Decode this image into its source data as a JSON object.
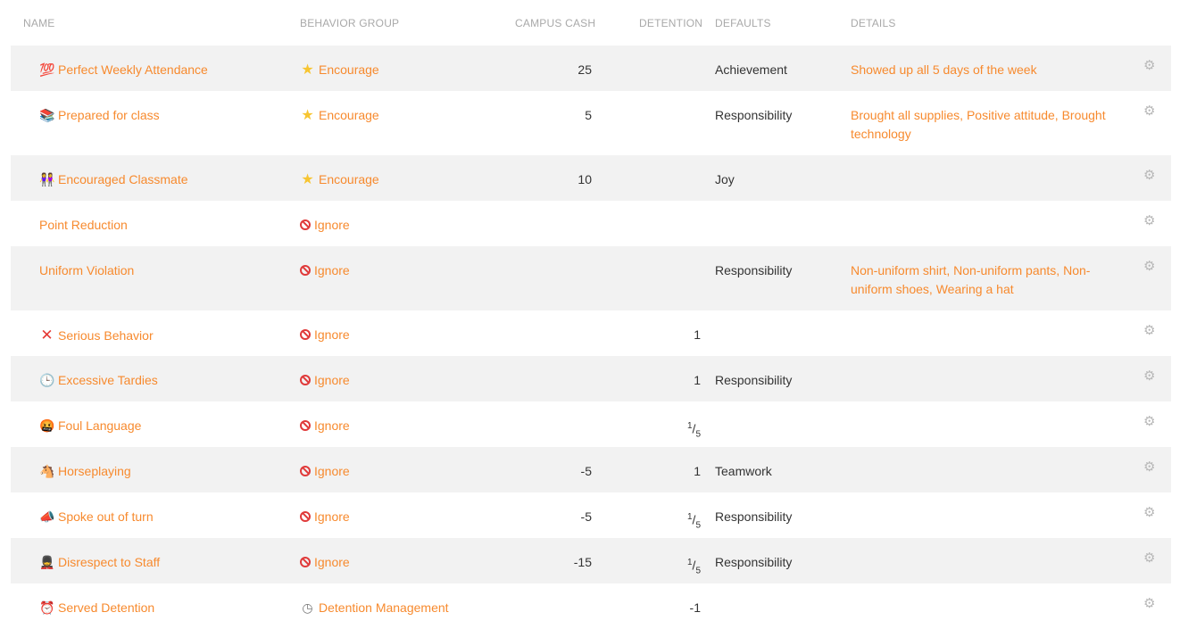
{
  "columns": {
    "name": "NAME",
    "group": "BEHAVIOR GROUP",
    "cash": "CAMPUS CASH",
    "detention": "DETENTION",
    "defaults": "DEFAULTS",
    "details": "DETAILS"
  },
  "rows": [
    {
      "icon": "hundred-points-icon",
      "name": "Perfect Weekly Attendance",
      "group_icon": "star-icon",
      "group": "Encourage",
      "cash": "25",
      "detention": "",
      "defaults": "Achievement",
      "details": "Showed up all 5 days of the week"
    },
    {
      "icon": "books-icon",
      "name": "Prepared for class",
      "group_icon": "star-icon",
      "group": "Encourage",
      "cash": "5",
      "detention": "",
      "defaults": "Responsibility",
      "details": "Brought all supplies, Positive attitude, Brought technology"
    },
    {
      "icon": "people-holding-hands-icon",
      "name": "Encouraged Classmate",
      "group_icon": "star-icon",
      "group": "Encourage",
      "cash": "10",
      "detention": "",
      "defaults": "Joy",
      "details": ""
    },
    {
      "icon": "",
      "name": "Point Reduction",
      "group_icon": "no-entry-icon",
      "group": "Ignore",
      "cash": "",
      "detention": "",
      "defaults": "",
      "details": ""
    },
    {
      "icon": "",
      "name": "Uniform Violation",
      "group_icon": "no-entry-icon",
      "group": "Ignore",
      "cash": "",
      "detention": "",
      "defaults": "Responsibility",
      "details": "Non-uniform shirt, Non-uniform pants, Non-uniform shoes, Wearing a hat"
    },
    {
      "icon": "cross-mark-icon",
      "name": "Serious Behavior",
      "group_icon": "no-entry-icon",
      "group": "Ignore",
      "cash": "",
      "detention": "1",
      "defaults": "",
      "details": ""
    },
    {
      "icon": "clock-icon",
      "name": "Excessive Tardies",
      "group_icon": "no-entry-icon",
      "group": "Ignore",
      "cash": "",
      "detention": "1",
      "defaults": "Responsibility",
      "details": ""
    },
    {
      "icon": "cursing-face-icon",
      "name": "Foul Language",
      "group_icon": "no-entry-icon",
      "group": "Ignore",
      "cash": "",
      "detention": "1/5",
      "defaults": "",
      "details": ""
    },
    {
      "icon": "horse-icon",
      "name": "Horseplaying",
      "group_icon": "no-entry-icon",
      "group": "Ignore",
      "cash": "-5",
      "detention": "1",
      "defaults": "Teamwork",
      "details": ""
    },
    {
      "icon": "megaphone-icon",
      "name": "Spoke out of turn",
      "group_icon": "no-entry-icon",
      "group": "Ignore",
      "cash": "-5",
      "detention": "1/5",
      "defaults": "Responsibility",
      "details": ""
    },
    {
      "icon": "guard-icon",
      "name": "Disrespect to Staff",
      "group_icon": "no-entry-icon",
      "group": "Ignore",
      "cash": "-15",
      "detention": "1/5",
      "defaults": "Responsibility",
      "details": ""
    },
    {
      "icon": "alarm-clock-icon",
      "name": "Served Detention",
      "group_icon": "clock-icon",
      "group": "Detention Management",
      "cash": "",
      "detention": "-1",
      "defaults": "",
      "details": ""
    }
  ]
}
